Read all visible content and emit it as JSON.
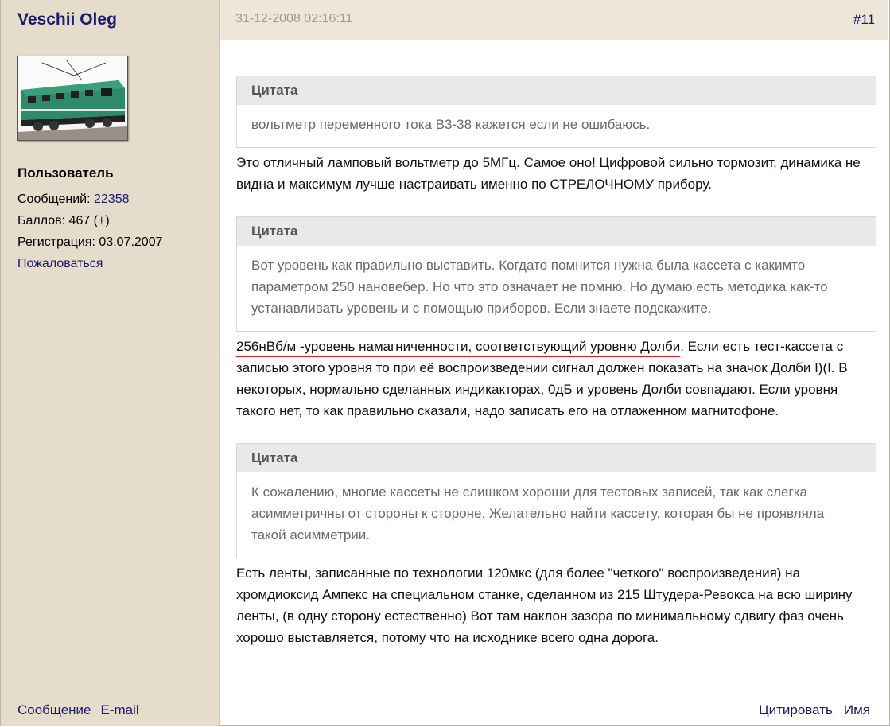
{
  "author": {
    "name": "Veschii Oleg",
    "role": "Пользователь",
    "messages_label": "Сообщений: ",
    "messages_count": "22358",
    "points_label": "Баллов: 467 (",
    "points_plus": "+",
    "points_close": ")",
    "registration": "Регистрация: 03.07.2007",
    "report": "Пожаловаться"
  },
  "header": {
    "date": "31-12-2008 02:16:11",
    "post_number": "#11"
  },
  "quote_title": "Цитата",
  "quotes": [
    "вольтметр переменного тока В3-38 кажется если не ошибаюсь.",
    "Вот уровень как правильно выставить. Когдато помнится нужна была кассета с какимто параметром 250 нановебер. Но что это означает не помню. Но думаю есть методика как-то устанавливать уровень и с помощью приборов. Если знаете подскажите.",
    "К сожалению, многие кассеты не слишком хороши для тестовых записей, так как слегка асимметричны от стороны к стороне. Желательно найти кассету, которая бы не проявляла такой асимметрии."
  ],
  "paragraphs": {
    "p1": "Это отличный ламповый вольтметр до 5МГц. Самое оно! Цифровой сильно тормозит, динамика не видна и максимум лучше настраивать именно по СТРЕЛОЧНОМУ прибору.",
    "p2_underlined": "256нВб/м -уровень намагниченности, соответствующий уровню Долби",
    "p2_rest": ". Если есть тест-кассета с записью этого уровня то при её воспроизведении сигнал должен показать на значок Долби I)(I. В некоторых, нормально сделанных индикакторах, 0дБ и уровень Долби совпадают. Если уровня такого нет, то как правильно сказали, надо записать его на отлаженном магнитофоне.",
    "p3": "Есть ленты, записанные по технологии 120мкс (для более \"четкого\" воспроизведения) на хромдиоксид Ампекс на специальном станке, сделанном из 215 Штудера-Ревокса на всю ширину ленты, (в одну сторону естественно) Вот там наклон зазора по минимальному сдвигу фаз очень хорошо выставляется, потому что на исходнике всего одна дорога."
  },
  "footer": {
    "message": "Сообщение",
    "email": "E-mail",
    "quote": "Цитировать",
    "name": "Имя"
  },
  "colors": {
    "sidebar": "#e6dccb",
    "link": "#1a1a6e",
    "underline": "#e0191c"
  }
}
